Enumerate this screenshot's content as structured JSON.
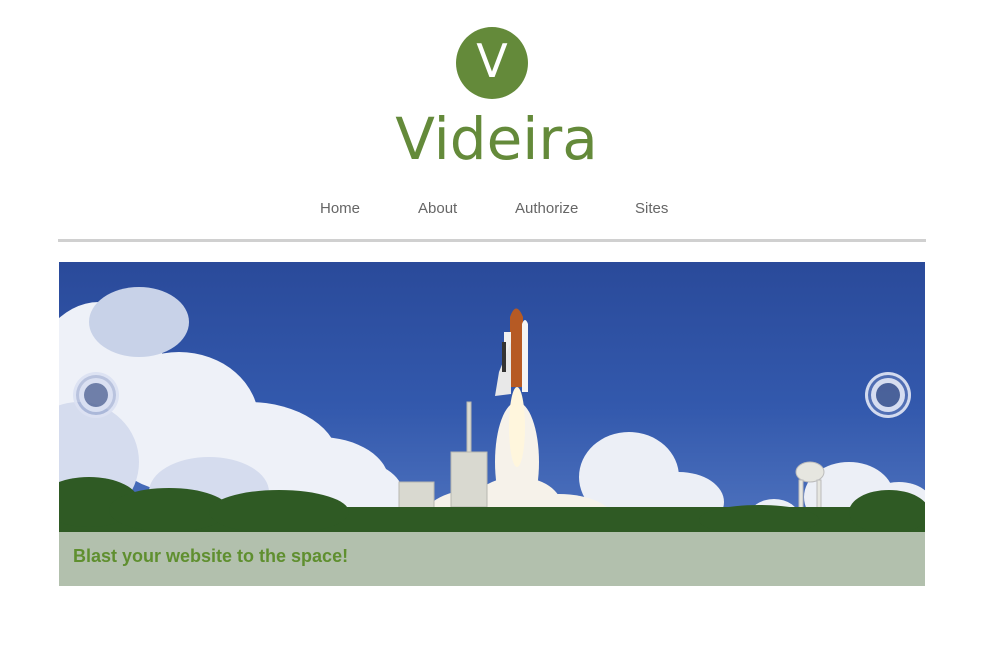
{
  "header": {
    "logo_letter": "V",
    "site_name": "Videira"
  },
  "nav": {
    "items": [
      {
        "label": "Home"
      },
      {
        "label": "About"
      },
      {
        "label": "Authorize"
      },
      {
        "label": "Sites"
      }
    ]
  },
  "carousel": {
    "caption": "Blast your website to the space!",
    "prev_icon": "circle-prev-icon",
    "next_icon": "circle-next-icon"
  },
  "colors": {
    "brand_green": "#648a3a",
    "caption_text": "#5f8f2f",
    "nav_text": "#666666",
    "sky_blue": "#3359ad"
  }
}
